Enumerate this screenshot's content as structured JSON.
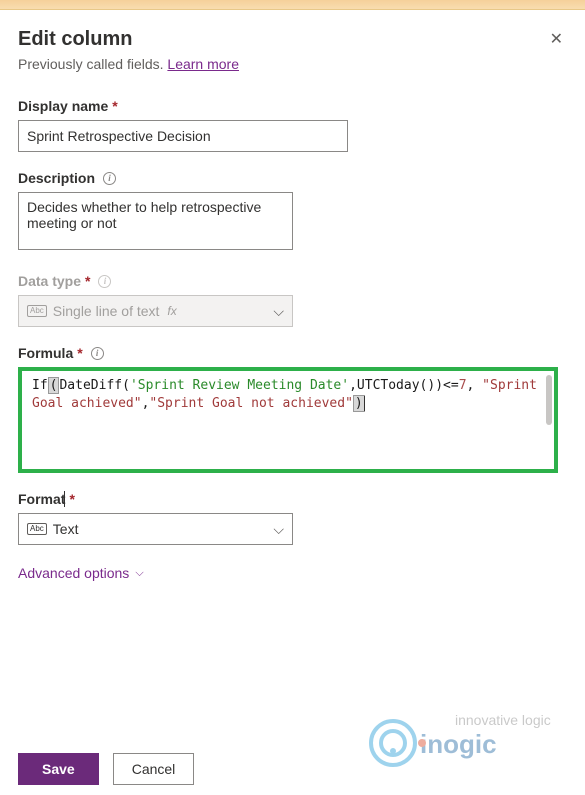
{
  "header": {
    "title": "Edit column",
    "subtitle_prefix": "Previously called fields. ",
    "learn_more": "Learn more"
  },
  "fields": {
    "display_name": {
      "label": "Display name",
      "value": "Sprint Retrospective Decision"
    },
    "description": {
      "label": "Description",
      "value": "Decides whether to help retrospective meeting or not"
    },
    "data_type": {
      "label": "Data type",
      "value": "Single line of text"
    },
    "formula": {
      "label": "Formula",
      "fn_if": "If",
      "fn_datediff": "DateDiff",
      "arg1": "'Sprint Review Meeting Date'",
      "fn_utctoday": "UTCToday",
      "op": "<=",
      "num": "7",
      "str1": "\"Sprint Goal achieved\"",
      "str2": "\"Sprint Goal not achieved\""
    },
    "format": {
      "label": "Format",
      "value": "Text"
    }
  },
  "advanced_options": "Advanced options",
  "buttons": {
    "save": "Save",
    "cancel": "Cancel"
  },
  "watermark": {
    "tagline": "innovative logic",
    "brand": "inogic"
  }
}
